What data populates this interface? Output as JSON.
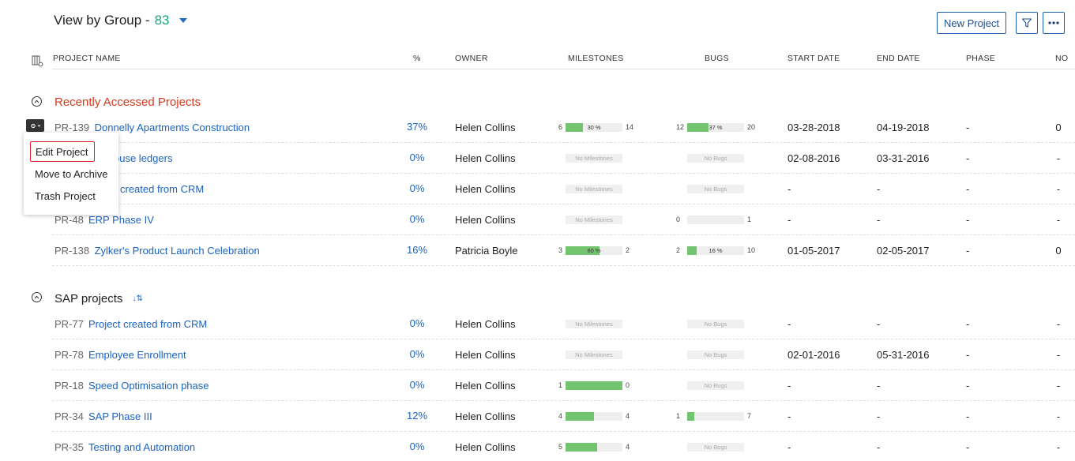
{
  "header": {
    "title": "View by Group - ",
    "count": "83",
    "new_project_label": "New Project"
  },
  "columns": {
    "name": "PROJECT NAME",
    "percent": "%",
    "owner": "OWNER",
    "milestones": "MILESTONES",
    "bugs": "BUGS",
    "start": "START DATE",
    "end": "END DATE",
    "phase": "PHASE",
    "no": "NO"
  },
  "context_menu": {
    "items": [
      "Edit Project",
      "Move to Archive",
      "Trash Project"
    ]
  },
  "groups": [
    {
      "title": "Recently Accessed Projects",
      "rows": [
        {
          "id": "PR-139",
          "name": "Donnelly Apartments Construction",
          "pct": "37%",
          "owner": "Helen Collins",
          "ms": {
            "left": "6",
            "right": "14",
            "fill": 0.3,
            "label": "30 %"
          },
          "bugs": {
            "left": "12",
            "right": "20",
            "fill": 0.37,
            "label": "37 %"
          },
          "start": "03-28-2018",
          "end": "04-19-2018",
          "phase": "-",
          "no": "0"
        },
        {
          "id": "",
          "name": "ouse ledgers",
          "pct": "0%",
          "owner": "Helen Collins",
          "ms": {
            "empty": "No Milestones"
          },
          "bugs": {
            "empty": "No Bugs"
          },
          "start": "02-08-2016",
          "end": "03-31-2016",
          "phase": "-",
          "no": "-"
        },
        {
          "id": "",
          "name": "created from CRM",
          "pct": "0%",
          "owner": "Helen Collins",
          "ms": {
            "empty": "No Milestones"
          },
          "bugs": {
            "empty": "No Bugs"
          },
          "start": "-",
          "end": "-",
          "phase": "-",
          "no": "-"
        },
        {
          "id": "PR-48",
          "name": "ERP Phase IV",
          "pct": "0%",
          "owner": "Helen Collins",
          "ms": {
            "empty": "No Milestones"
          },
          "bugs": {
            "left": "0",
            "right": "1",
            "fill": 0,
            "label": ""
          },
          "start": "-",
          "end": "-",
          "phase": "-",
          "no": "-"
        },
        {
          "id": "PR-138",
          "name": "Zylker's Product Launch Celebration",
          "pct": "16%",
          "owner": "Patricia Boyle",
          "ms": {
            "left": "3",
            "right": "2",
            "fill": 0.6,
            "label": "60 %"
          },
          "bugs": {
            "left": "2",
            "right": "10",
            "fill": 0.16,
            "label": "16 %"
          },
          "start": "01-05-2017",
          "end": "02-05-2017",
          "phase": "-",
          "no": "0"
        }
      ]
    },
    {
      "title": "SAP projects",
      "sort_icon": "↓⇅",
      "rows": [
        {
          "id": "PR-77",
          "name": "Project created from CRM",
          "pct": "0%",
          "owner": "Helen Collins",
          "ms": {
            "empty": "No Milestones"
          },
          "bugs": {
            "empty": "No Bugs"
          },
          "start": "-",
          "end": "-",
          "phase": "-",
          "no": "-"
        },
        {
          "id": "PR-78",
          "name": "Employee Enrollment",
          "pct": "0%",
          "owner": "Helen Collins",
          "ms": {
            "empty": "No Milestones"
          },
          "bugs": {
            "empty": "No Bugs"
          },
          "start": "02-01-2016",
          "end": "05-31-2016",
          "phase": "-",
          "no": "-"
        },
        {
          "id": "PR-18",
          "name": "Speed Optimisation phase",
          "pct": "0%",
          "owner": "Helen Collins",
          "ms": {
            "left": "1",
            "right": "0",
            "fill": 1.0,
            "label": ""
          },
          "bugs": {
            "empty": "No Bugs"
          },
          "start": "-",
          "end": "-",
          "phase": "-",
          "no": "-"
        },
        {
          "id": "PR-34",
          "name": "SAP Phase III",
          "pct": "12%",
          "owner": "Helen Collins",
          "ms": {
            "left": "4",
            "right": "4",
            "fill": 0.5,
            "label": ""
          },
          "bugs": {
            "left": "1",
            "right": "7",
            "fill": 0.125,
            "label": ""
          },
          "start": "-",
          "end": "-",
          "phase": "-",
          "no": "-"
        },
        {
          "id": "PR-35",
          "name": "Testing and Automation",
          "pct": "0%",
          "owner": "Helen Collins",
          "ms": {
            "left": "5",
            "right": "4",
            "fill": 0.55,
            "label": ""
          },
          "bugs": {
            "empty": "No Bugs"
          },
          "start": "-",
          "end": "-",
          "phase": "-",
          "no": "-"
        }
      ]
    }
  ]
}
